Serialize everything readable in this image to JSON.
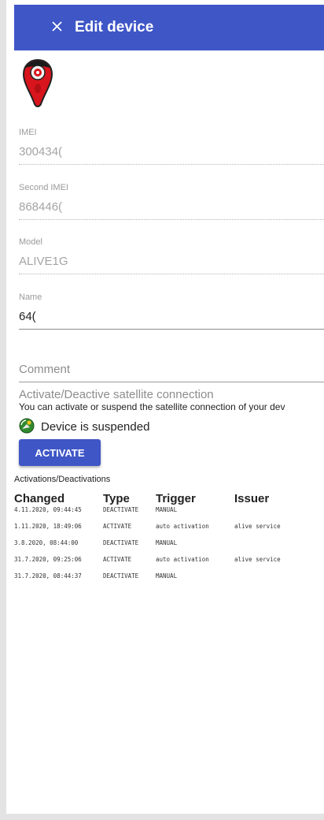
{
  "header": {
    "title": "Edit device"
  },
  "fields": [
    {
      "label": "IMEI",
      "value": "300434("
    },
    {
      "label": "Second IMEI",
      "value": "868446("
    },
    {
      "label": "Model",
      "value": "ALIVE1G"
    },
    {
      "label": "Name",
      "value": "64("
    }
  ],
  "comment": {
    "label": "Comment"
  },
  "satellite": {
    "title": "Activate/Deactive satellite connection",
    "description": "You can activate or suspend the satellite connection of your dev",
    "status": "Device is suspended",
    "activate_label": "ACTIVATE"
  },
  "history": {
    "title": "Activations/Deactivations",
    "columns": [
      "Changed",
      "Type",
      "Trigger",
      "Issuer"
    ],
    "rows": [
      {
        "changed": "4.11.2020, 09:44:45",
        "type": "DEACTIVATE",
        "trigger": "MANUAL",
        "issuer": ""
      },
      {
        "changed": "1.11.2020, 18:49:06",
        "type": "ACTIVATE",
        "trigger": "auto activation",
        "issuer": "alive service"
      },
      {
        "changed": "3.8.2020, 08:44:00",
        "type": "DEACTIVATE",
        "trigger": "MANUAL",
        "issuer": ""
      },
      {
        "changed": "31.7.2020, 09:25:06",
        "type": "ACTIVATE",
        "trigger": "auto activation",
        "issuer": "alive service"
      },
      {
        "changed": "31.7.2020, 08:44:37",
        "type": "DEACTIVATE",
        "trigger": "MANUAL",
        "issuer": ""
      }
    ]
  },
  "colors": {
    "accent": "#3f56c7",
    "device_red": "#d8141c"
  },
  "icons": {
    "close": "close-icon",
    "device": "gps-tracker-device-icon",
    "status": "satellite-status-icon"
  }
}
